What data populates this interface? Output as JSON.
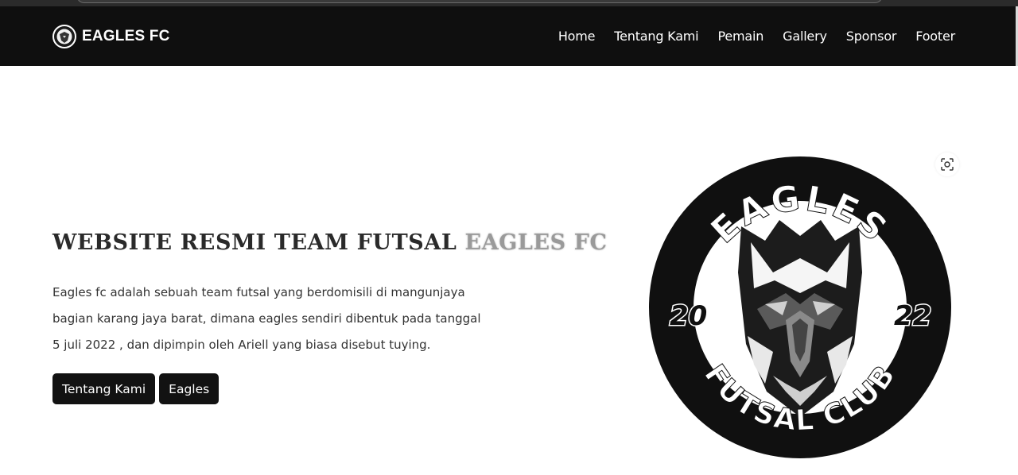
{
  "navbar": {
    "brand": "EAGLES FC",
    "links": [
      "Home",
      "Tentang Kami",
      "Pemain",
      "Gallery",
      "Sponsor",
      "Footer"
    ]
  },
  "hero": {
    "title_main": "WEBSITE RESMI TEAM FUTSAL",
    "title_accent": "EAGLES FC",
    "description_lines": [
      "Eagles fc adalah sebuah team futsal yang berdomisili di mangunjaya",
      "bagian karang jaya barat, dimana eagles sendiri dibentuk pada tanggal",
      "5 juli 2022 , dan dipimpin oleh Ariell yang biasa disebut tuying."
    ],
    "buttons": [
      "Tentang Kami",
      "Eagles"
    ]
  },
  "emblem": {
    "top_text": "EAGLES",
    "year_left": "20",
    "year_right": "22",
    "bottom_text": "FUTSAL CLUB"
  },
  "icons": {
    "brand": "eagle-logo-icon",
    "lens": "visual-search-icon"
  },
  "colors": {
    "navbar_bg": "#0f0f0f",
    "button_bg": "#121212",
    "title_accent": "#9a9a9a"
  }
}
